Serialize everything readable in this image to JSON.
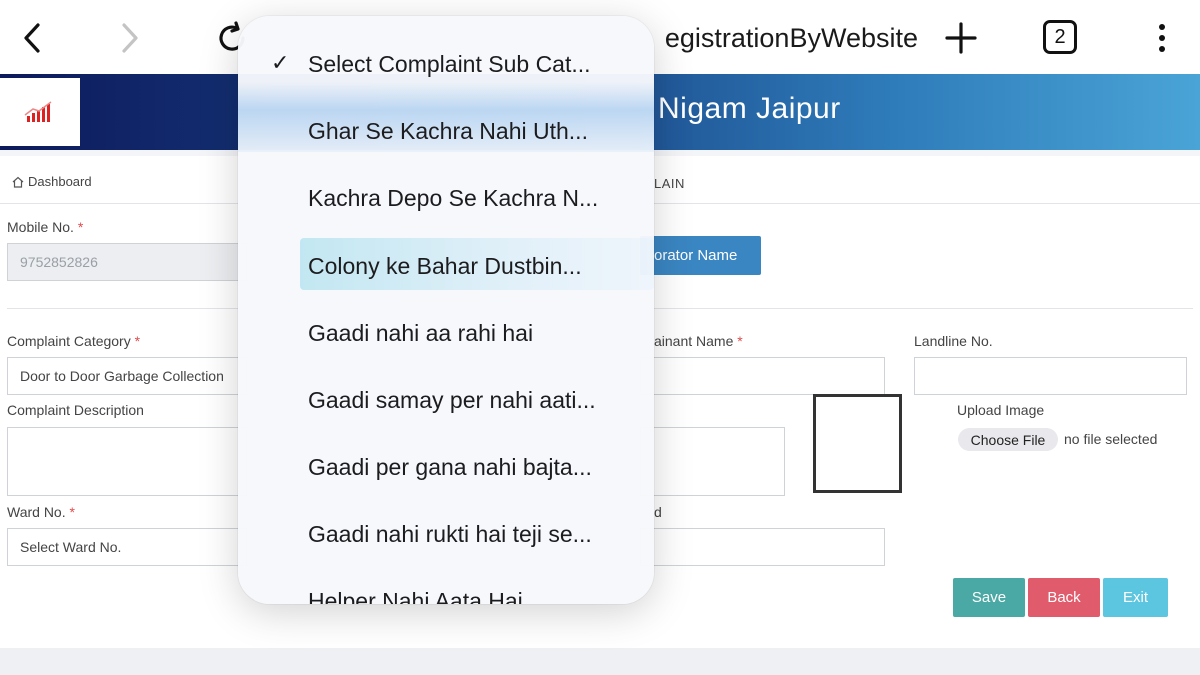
{
  "browser": {
    "url_text": "egistrationByWebsite",
    "tab_count": "2"
  },
  "header": {
    "title": "Nigam Jaipur"
  },
  "breadcrumb": {
    "dashboard": "Dashboard",
    "right_text": "LAIN"
  },
  "form": {
    "mobile_label": "Mobile No.",
    "mobile_value": "9752852826",
    "corporator_button": "orator Name",
    "category_label": "Complaint Category",
    "category_value": "Door to Door Garbage Collection",
    "complainant_label": "ainant Name",
    "landline_label": "Landline No.",
    "description_label": "Complaint Description",
    "upload_label": "Upload Image",
    "choose_file": "Choose File",
    "no_file": "no file selected",
    "ward_label": "Ward No.",
    "ward_placeholder": "Select Ward No.",
    "d_label": "d",
    "required_mark": "*"
  },
  "actions": {
    "save": "Save",
    "back": "Back",
    "exit": "Exit"
  },
  "dropdown": {
    "selected": "Select Complaint Sub Cat...",
    "options": [
      "Ghar Se Kachra Nahi Uth...",
      "Kachra Depo Se Kachra N...",
      "Colony ke Bahar Dustbin...",
      "Gaadi nahi aa rahi hai",
      "Gaadi samay per nahi aati...",
      "Gaadi per gana nahi bajta...",
      "Gaadi nahi rukti hai teji se...",
      "Helper Nahi Aata Hai"
    ]
  },
  "colors": {
    "header_dark": "#0d1a5c",
    "header_light": "#4aa4d6",
    "corporator_btn": "#3a86c2",
    "save": "#4aa9a4",
    "back": "#e05c6c",
    "exit": "#5cc6e0",
    "required": "#e04b4b"
  }
}
